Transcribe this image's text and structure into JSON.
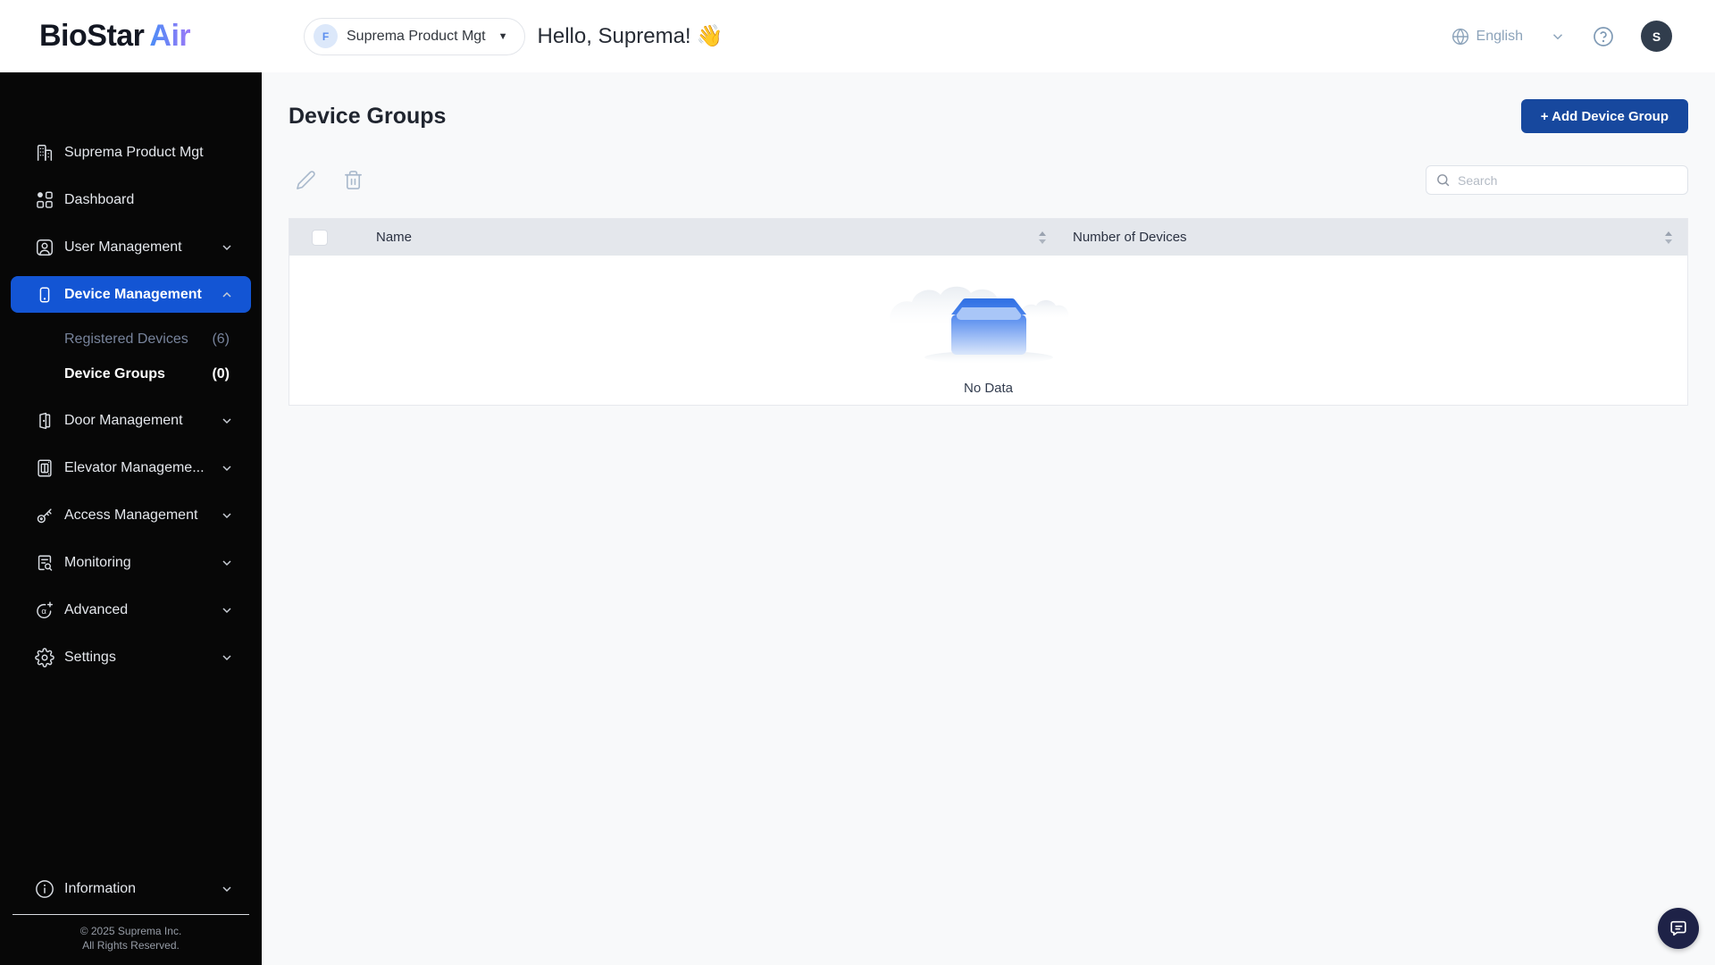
{
  "header": {
    "logo_primary": "BioStar",
    "logo_secondary": "Air",
    "org_badge": "F",
    "org_name": "Suprema Product Mgt",
    "greeting": "Hello, Suprema!",
    "greeting_emoji": "👋",
    "language": "English",
    "avatar_initial": "S"
  },
  "sidebar": {
    "items": [
      {
        "label": "Suprema Product Mgt",
        "icon": "building-icon"
      },
      {
        "label": "Dashboard",
        "icon": "dashboard-icon"
      },
      {
        "label": "User Management",
        "icon": "user-icon"
      },
      {
        "label": "Device Management",
        "icon": "device-icon",
        "active": true
      },
      {
        "label": "Door Management",
        "icon": "door-icon"
      },
      {
        "label": "Elevator Manageme...",
        "icon": "elevator-icon"
      },
      {
        "label": "Access Management",
        "icon": "key-icon"
      },
      {
        "label": "Monitoring",
        "icon": "monitoring-icon"
      },
      {
        "label": "Advanced",
        "icon": "advanced-icon"
      },
      {
        "label": "Settings",
        "icon": "gear-icon"
      }
    ],
    "device_submenu": [
      {
        "label": "Registered Devices",
        "count": "(6)",
        "active": false
      },
      {
        "label": "Device Groups",
        "count": "(0)",
        "active": true
      }
    ],
    "information_label": "Information",
    "footer_line1": "© 2025 Suprema Inc.",
    "footer_line2": "All Rights Reserved."
  },
  "main": {
    "title": "Device Groups",
    "add_button_label": "+ Add Device Group",
    "search_placeholder": "Search",
    "table": {
      "columns": [
        "Name",
        "Number of Devices"
      ],
      "rows": [],
      "empty_text": "No Data"
    }
  },
  "colors": {
    "sidebar_active": "#1355d4",
    "primary_button": "#17489e",
    "header_muted": "#8ca3ba",
    "table_header_bg": "#e4e7ec",
    "chat_button": "#1e2247"
  }
}
